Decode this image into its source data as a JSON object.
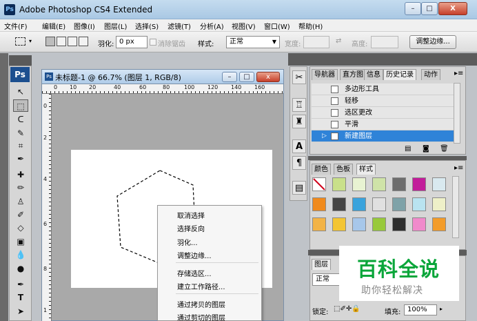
{
  "window": {
    "title": "Adobe Photoshop CS4 Extended",
    "app_icon": "Ps",
    "minimize": "–",
    "maximize": "□",
    "close": "X"
  },
  "menu": [
    "文件(F)",
    "编辑(E)",
    "图像(I)",
    "图层(L)",
    "选择(S)",
    "滤镜(T)",
    "分析(A)",
    "视图(V)",
    "窗口(W)",
    "帮助(H)"
  ],
  "options_bar": {
    "feather_label": "羽化:",
    "feather_value": "0 px",
    "antialias_label": "消除锯齿",
    "style_label": "样式:",
    "style_value": "正常",
    "width_label": "宽度:",
    "height_label": "高度:",
    "refine_button": "调整边缘..."
  },
  "toolbox": {
    "badge": "Ps",
    "tools": [
      "move-tool",
      "marquee-tool",
      "lasso-tool",
      "quick-select-tool",
      "crop-tool",
      "eyedropper-tool",
      "healing-brush-tool",
      "brush-tool",
      "clone-stamp-tool",
      "history-brush-tool",
      "eraser-tool",
      "gradient-tool",
      "blur-tool",
      "dodge-tool",
      "pen-tool",
      "type-tool",
      "path-select-tool"
    ]
  },
  "document": {
    "title": "未标题-1 @ 66.7% (图层 1, RGB/8)",
    "ruler_top": [
      "0",
      "10",
      "20",
      "40",
      "60",
      "80",
      "100",
      "120",
      "140",
      "160"
    ],
    "ruler_left": [
      "0",
      "2",
      "4",
      "6",
      "8",
      "1"
    ]
  },
  "context_menu": [
    "取消选择",
    "选择反向",
    "羽化...",
    "调整边缘...",
    "存储选区...",
    "建立工作路径...",
    "通过拷贝的图层",
    "通过剪切的图层"
  ],
  "history_panel": {
    "tabs": [
      "导航器",
      "直方图",
      "信息",
      "历史记录",
      "动作"
    ],
    "active_tab": "历史记录",
    "items": [
      "多边形工具",
      "轻移",
      "选区更改",
      "平滑",
      "新建图层"
    ],
    "selected_item": "新建图层"
  },
  "styles_panel": {
    "tabs": [
      "颜色",
      "色板",
      "样式"
    ],
    "active_tab": "样式",
    "swatch_colors": [
      [
        "#ffffff",
        "#c9e08a",
        "#e8f3d2",
        "#cfe3a8",
        "#6d6d6d",
        "#c21d9a",
        "#d9e9ef"
      ],
      [
        "#f08a1c",
        "#444444",
        "#3aa3dc",
        "#e0e0e0",
        "#7ea2a8",
        "#b9e3f0",
        "#eef0c8"
      ],
      [
        "#f2b347",
        "#f3c533",
        "#a7c7ea",
        "#98c93b",
        "#2e2e2e",
        "#f08acb",
        "#f39c2a"
      ]
    ]
  },
  "layers_panel": {
    "tabs": [
      "图层"
    ],
    "blend_mode": "正常",
    "lock_label": "锁定:",
    "fill_label": "填充:",
    "fill_value": "100%"
  },
  "watermark": {
    "title": "百科全说",
    "subtitle": "助你轻松解决"
  }
}
